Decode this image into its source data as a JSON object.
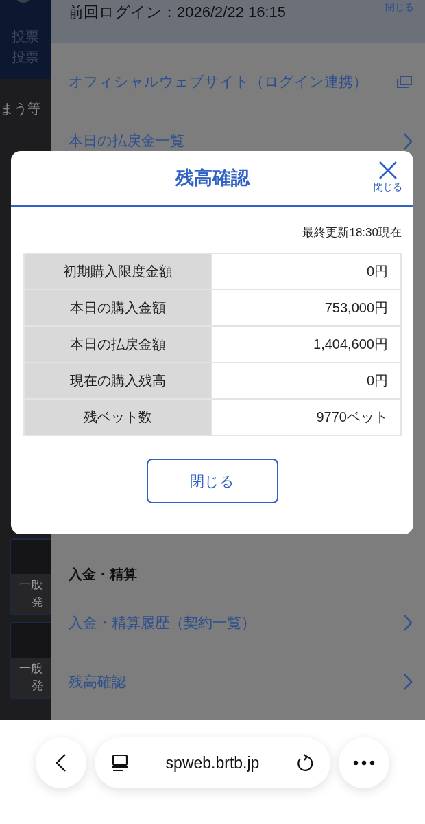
{
  "background_page": {
    "header_lines": [
      "投票",
      "投票"
    ],
    "notice_fragment": "まう等",
    "cards": [
      {
        "line_1": "一般",
        "line_2": "発"
      },
      {
        "line_1": "一般",
        "line_2": "発"
      }
    ]
  },
  "drawer": {
    "close_label": "閉じる",
    "last_login": "前回ログイン：2026/2/22 16:15",
    "items": [
      {
        "kind": "external",
        "label": "オフィシャルウェブサイト（ログイン連携）"
      },
      {
        "kind": "link",
        "label": "本日の払戻金一覧"
      }
    ],
    "section": {
      "title": "入金・精算",
      "items": [
        {
          "kind": "link",
          "label": "入金・精算履歴（契約一覧）"
        },
        {
          "kind": "link",
          "label": "残高確認"
        }
      ]
    }
  },
  "modal": {
    "title": "残高確認",
    "close_label": "閉じる",
    "updated": "最終更新18:30現在",
    "rows": [
      {
        "label": "初期購入限度金額",
        "value": "0円"
      },
      {
        "label": "本日の購入金額",
        "value": "753,000円"
      },
      {
        "label": "本日の払戻金額",
        "value": "1,404,600円"
      },
      {
        "label": "現在の購入残高",
        "value": "0円"
      },
      {
        "label": "残ベット数",
        "value": "9770ベット"
      }
    ],
    "button": "閉じる"
  },
  "browser_bar": {
    "url": "spweb.brtb.jp"
  }
}
